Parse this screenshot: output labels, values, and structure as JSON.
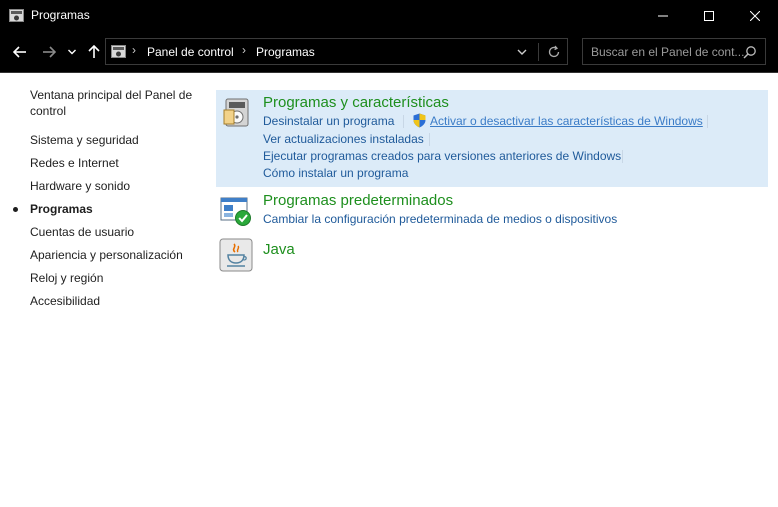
{
  "window": {
    "title": "Programas"
  },
  "address": {
    "crumbs": [
      "Panel de control",
      "Programas"
    ]
  },
  "search": {
    "placeholder": "Buscar en el Panel de cont..."
  },
  "sidebar": {
    "items": [
      {
        "label": "Ventana principal del Panel de control"
      },
      {
        "label": "Sistema y seguridad"
      },
      {
        "label": "Redes e Internet"
      },
      {
        "label": "Hardware y sonido"
      },
      {
        "label": "Programas",
        "active": true
      },
      {
        "label": "Cuentas de usuario"
      },
      {
        "label": "Apariencia y personalización"
      },
      {
        "label": "Reloj y región"
      },
      {
        "label": "Accesibilidad"
      }
    ]
  },
  "categories": [
    {
      "title": "Programas y características",
      "icon": "programs-features-icon",
      "links": [
        "Desinstalar un programa",
        "Activar o desactivar las características de Windows",
        "Ver actualizaciones instaladas",
        "Ejecutar programas creados para versiones anteriores de Windows",
        "Cómo instalar un programa"
      ]
    },
    {
      "title": "Programas predeterminados",
      "icon": "default-programs-icon",
      "links": [
        "Cambiar la configuración predeterminada de medios o dispositivos"
      ]
    },
    {
      "title": "Java",
      "icon": "java-icon",
      "links": []
    }
  ],
  "colors": {
    "titlebar": "#000000",
    "category_title": "#1e8f1e",
    "link": "#1f5a9a",
    "highlight_bg": "#dcebf8"
  }
}
